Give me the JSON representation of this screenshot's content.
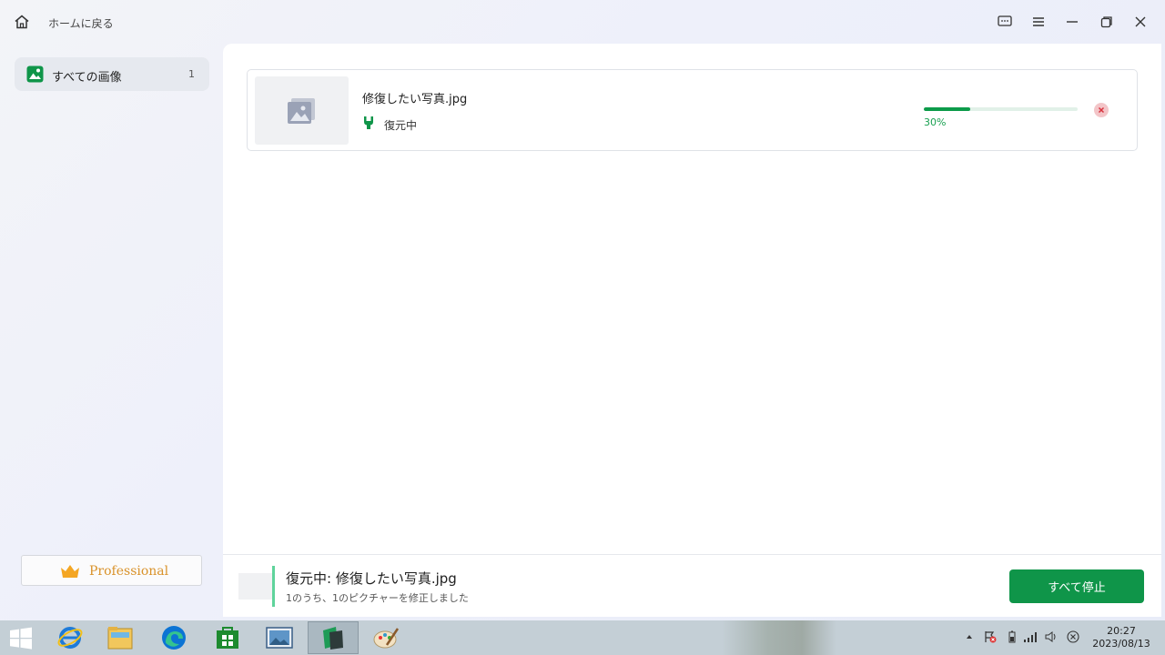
{
  "titlebar": {
    "home_label": "ホームに戻る",
    "icons": [
      "home-icon",
      "feedback-icon",
      "menu-icon",
      "minimize-icon",
      "restore-icon",
      "close-icon"
    ]
  },
  "sidebar": {
    "items": [
      {
        "label": "すべての画像",
        "count": "1",
        "icon": "image-icon"
      }
    ],
    "pro_label": "Professional"
  },
  "recovery": {
    "items": [
      {
        "filename": "修復したい写真.jpg",
        "status": "復元中",
        "progress_value": 0.3,
        "progress_text": "30%"
      }
    ]
  },
  "footer": {
    "title": "復元中: 修復したい写真.jpg",
    "subtitle": "1のうち、1のピクチャーを修正しました",
    "stop_label": "すべて停止"
  },
  "taskbar": {
    "apps": [
      "internet-explorer",
      "file-explorer",
      "edge",
      "store",
      "photo-viewer",
      "repair-app",
      "paint"
    ],
    "time": "20:27",
    "date": "2023/08/13"
  },
  "colors": {
    "accent": "#0f9549",
    "progress_track": "#e1f1e8",
    "pro_text": "#d9922a",
    "cancel_bg": "#f3c5c8"
  }
}
